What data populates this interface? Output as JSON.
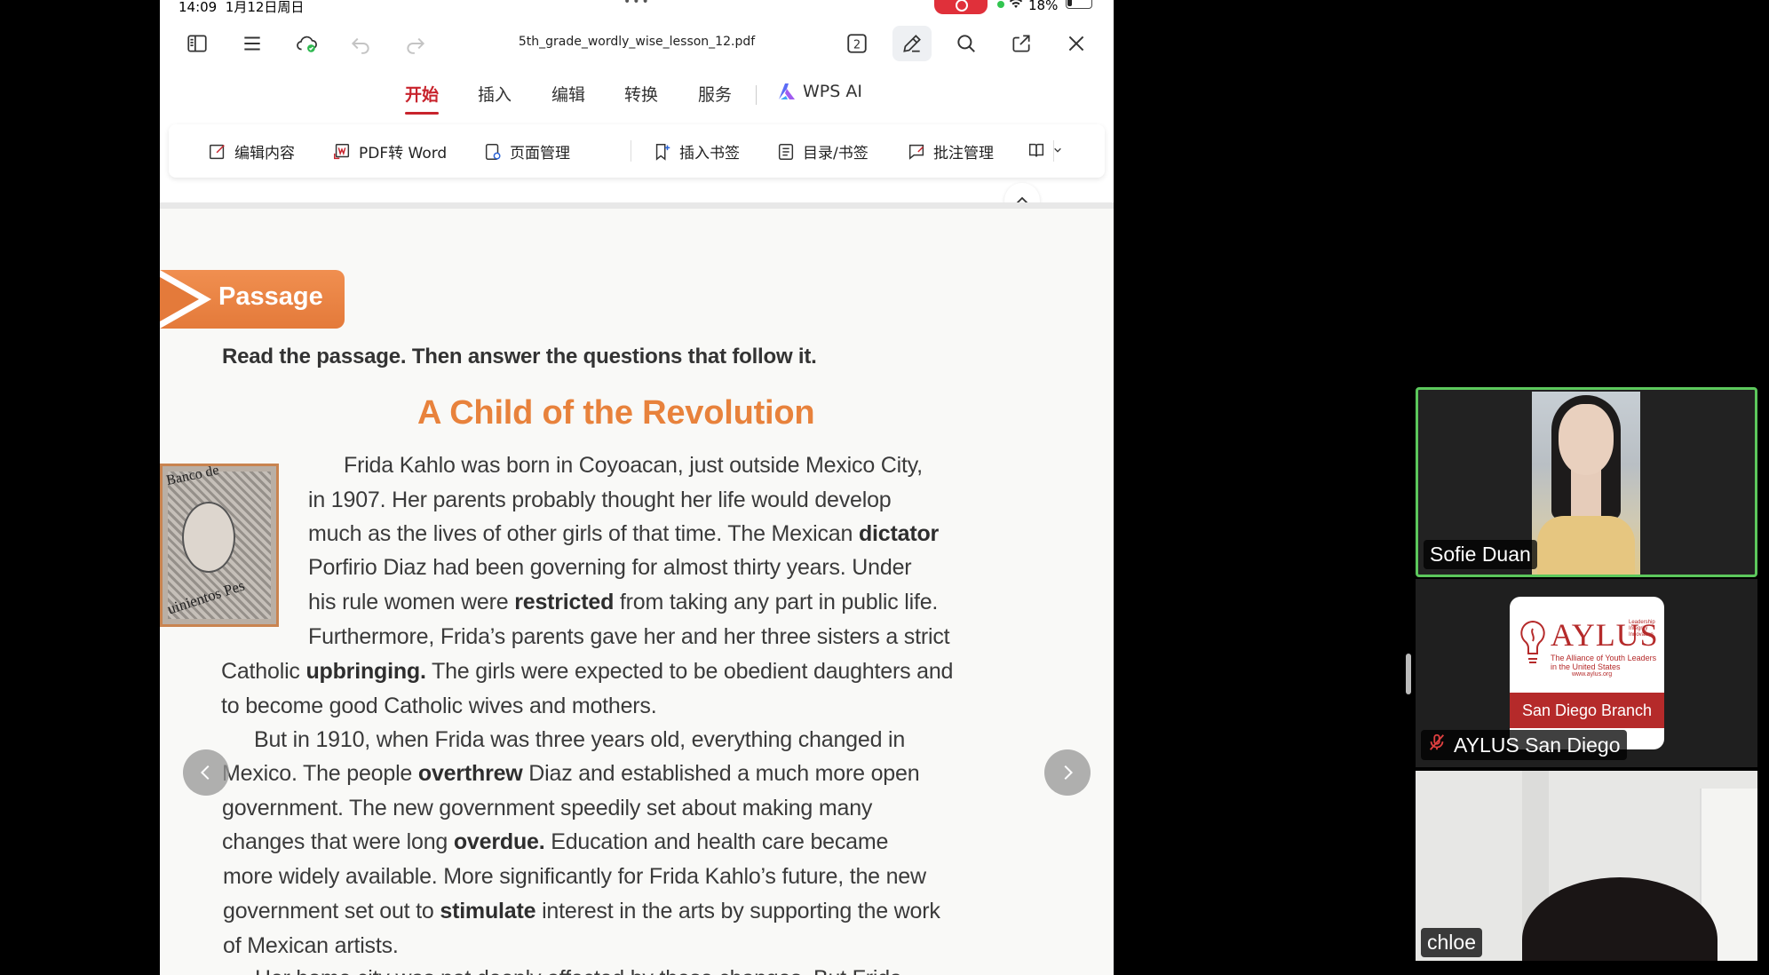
{
  "status_bar": {
    "time": "14:09",
    "date": "1月12日周日",
    "battery": "18%"
  },
  "toolbar": {
    "filename": "5th_grade_wordly_wise_lesson_12.pdf",
    "page_badge": "2"
  },
  "tabs": [
    {
      "label": "开始",
      "active": true
    },
    {
      "label": "插入"
    },
    {
      "label": "编辑"
    },
    {
      "label": "转换"
    },
    {
      "label": "服务"
    }
  ],
  "wps_ai_label": "WPS AI",
  "ribbon": {
    "edit_content": "编辑内容",
    "pdf_to_word": "PDF转 Word",
    "page_manage": "页面管理",
    "insert_bookmark": "插入书签",
    "toc_bookmark": "目录/书签",
    "annotation_manage": "批注管理"
  },
  "pdf": {
    "passage_label": "Passage",
    "instruction": "Read the passage. Then answer the questions that follow it.",
    "title": "A Child of the Revolution",
    "stamp_text_top": "Banco de",
    "stamp_text_bottom": "uinientos Pes",
    "lines": [
      {
        "pre": "Frida Kahlo was born in Coyoacan, just outside Mexico City,",
        "bold": "",
        "post": ""
      },
      {
        "pre": "in 1907. Her parents probably thought her life would develop",
        "bold": "",
        "post": ""
      },
      {
        "pre": "much as the lives of other girls of that time. The Mexican ",
        "bold": "dictator",
        "post": ""
      },
      {
        "pre": "Porfirio Diaz had been governing for almost thirty years. Under",
        "bold": "",
        "post": ""
      },
      {
        "pre": "his rule women were ",
        "bold": "restricted",
        "post": " from taking any part in public life."
      },
      {
        "pre": "Furthermore, Frida’s parents gave her and her three sisters a strict",
        "bold": "",
        "post": ""
      },
      {
        "pre": "Catholic ",
        "bold": "upbringing.",
        "post": " The girls were expected to be obedient daughters and"
      },
      {
        "pre": "to become good Catholic wives and mothers.",
        "bold": "",
        "post": ""
      },
      {
        "pre": "But in 1910, when Frida was three years old, everything changed in",
        "bold": "",
        "post": ""
      },
      {
        "pre": "Mexico. The people ",
        "bold": "overthrew",
        "post": " Diaz and established a much more open"
      },
      {
        "pre": "government. The new government speedily set about making many",
        "bold": "",
        "post": ""
      },
      {
        "pre": "changes that were long ",
        "bold": "overdue.",
        "post": " Education and health care became"
      },
      {
        "pre": "more widely available. More significantly for Frida Kahlo’s future, the new",
        "bold": "",
        "post": ""
      },
      {
        "pre": "government set out to ",
        "bold": "stimulate",
        "post": " interest in the arts by supporting the work"
      },
      {
        "pre": "of Mexican artists.",
        "bold": "",
        "post": ""
      },
      {
        "pre": "Her home city was not deeply affected by these changes. But Frida",
        "bold": "",
        "post": ""
      }
    ]
  },
  "participants": [
    {
      "name": "Sofie Duan",
      "active_speaker": true
    },
    {
      "name": "AYLUS San Diego",
      "muted": true
    },
    {
      "name": "chloe"
    }
  ],
  "aylus_logo": {
    "title": "AYLUS",
    "subtitle": "The Alliance of Youth Leaders in the United States",
    "tagline": "Leadership Integrity Innovation",
    "url": "www.aylus.org",
    "branch": "San Diego Branch"
  },
  "colors": {
    "accent_tab": "#c8232c",
    "passage_orange": "#e8823c",
    "active_speaker_border": "#5cc85c",
    "aylus_red": "#b52a2a"
  }
}
